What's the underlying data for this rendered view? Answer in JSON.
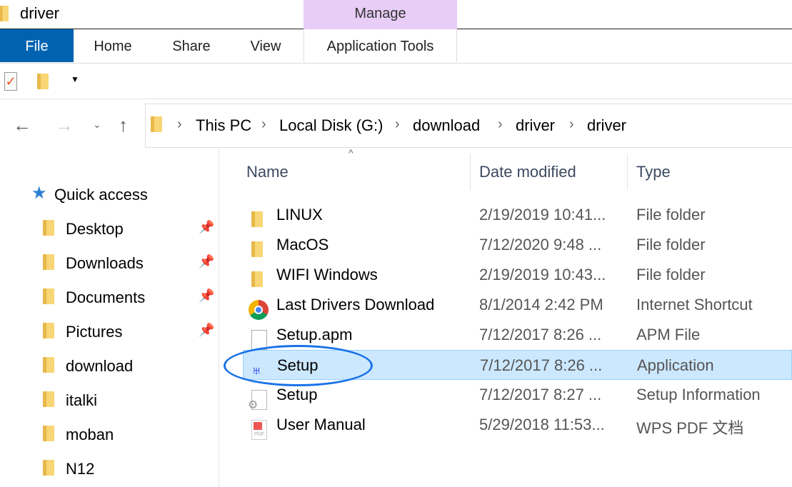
{
  "window": {
    "title": "driver"
  },
  "ribbon": {
    "context_group": "Manage",
    "tabs": [
      "File",
      "Home",
      "Share",
      "View",
      "Application Tools"
    ]
  },
  "address": {
    "crumbs": [
      "This PC",
      "Local Disk (G:)",
      "download",
      "driver",
      "driver"
    ]
  },
  "columns": {
    "name": "Name",
    "date": "Date modified",
    "type": "Type"
  },
  "nav": {
    "quick_access": "Quick access",
    "items": [
      {
        "label": "Desktop",
        "pinned": true
      },
      {
        "label": "Downloads",
        "pinned": true
      },
      {
        "label": "Documents",
        "pinned": true
      },
      {
        "label": "Pictures",
        "pinned": true
      },
      {
        "label": "download"
      },
      {
        "label": "italki"
      },
      {
        "label": "moban"
      },
      {
        "label": "N12"
      }
    ]
  },
  "files": [
    {
      "name": "LINUX",
      "date": "2/19/2019 10:41...",
      "type": "File folder",
      "icon": "folder-icon"
    },
    {
      "name": "MacOS",
      "date": "7/12/2020 9:48 ...",
      "type": "File folder",
      "icon": "folder-icon"
    },
    {
      "name": "WIFI Windows",
      "date": "2/19/2019 10:43...",
      "type": "File folder",
      "icon": "folder-icon"
    },
    {
      "name": "Last Drivers Download",
      "date": "8/1/2014 2:42 PM",
      "type": "Internet Shortcut",
      "icon": "chrome-shortcut-icon"
    },
    {
      "name": "Setup.apm",
      "date": "7/12/2017 8:26 ...",
      "type": "APM File",
      "icon": "file-icon"
    },
    {
      "name": "Setup",
      "date": "7/12/2017 8:26 ...",
      "type": "Application",
      "icon": "setup-app-icon",
      "selected": true
    },
    {
      "name": "Setup",
      "date": "7/12/2017 8:27 ...",
      "type": "Setup Information",
      "icon": "setup-info-icon"
    },
    {
      "name": "User Manual",
      "date": "5/29/2018 11:53...",
      "type": "WPS PDF 文档",
      "icon": "pdf-icon"
    }
  ],
  "colors": {
    "file_tab": "#0063b1",
    "manage": "#e8cdf7",
    "selection": "#cce8ff",
    "highlight_ellipse": "#1a73e8"
  }
}
